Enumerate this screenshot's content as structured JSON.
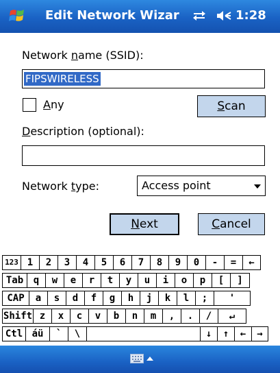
{
  "titlebar": {
    "title": "Edit Network Wizar",
    "time": "1:28"
  },
  "form": {
    "ssid_label": {
      "before": "Network ",
      "ul": "n",
      "after": "ame (SSID):"
    },
    "ssid_value": "FIPSWIRELESS",
    "any_label": {
      "ul": "A",
      "after": "ny"
    },
    "scan_button": {
      "ul": "S",
      "after": "can"
    },
    "desc_label": {
      "ul": "D",
      "after": "escription (optional):"
    },
    "desc_value": "",
    "type_label": {
      "before": "Network ",
      "ul": "t",
      "after": "ype:"
    },
    "type_value": "Access point",
    "next_button": {
      "ul": "N",
      "after": "ext"
    },
    "cancel_button": {
      "ul": "C",
      "after": "ancel"
    }
  },
  "keyboard": {
    "rows": [
      [
        "123",
        "1",
        "2",
        "3",
        "4",
        "5",
        "6",
        "7",
        "8",
        "9",
        "0",
        "-",
        "=",
        "←"
      ],
      [
        "Tab",
        "q",
        "w",
        "e",
        "r",
        "t",
        "y",
        "u",
        "i",
        "o",
        "p",
        "[",
        "]"
      ],
      [
        "CAP",
        "a",
        "s",
        "d",
        "f",
        "g",
        "h",
        "j",
        "k",
        "l",
        ";",
        "'"
      ],
      [
        "Shift",
        "z",
        "x",
        "c",
        "v",
        "b",
        "n",
        "m",
        ",",
        ".",
        "/",
        "↵"
      ],
      [
        "Ctl",
        "áü",
        "`",
        "\\",
        "",
        "↓",
        "↑",
        "←",
        "→"
      ]
    ]
  },
  "icons": {
    "start": "windows-flag-icon",
    "connectivity": "connectivity-icon",
    "volume": "volume-icon",
    "input_panel": "keyboard-icon"
  },
  "colors": {
    "titlebar": "#1a62c4",
    "selection": "#3169c6",
    "button": "#c3d6ec"
  }
}
